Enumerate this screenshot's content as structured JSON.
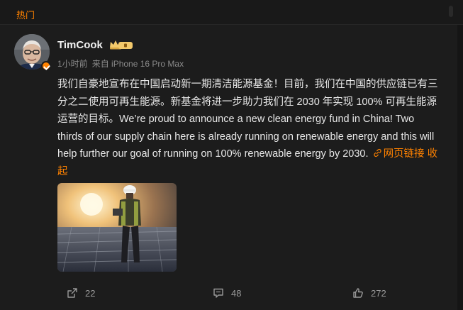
{
  "top": {
    "tab_label": "热门"
  },
  "post": {
    "username": "TimCook",
    "time": "1小时前",
    "source": "来自 iPhone 16 Pro Max",
    "text": "我们自豪地宣布在中国启动新一期清洁能源基金！目前，我们在中国的供应链已有三分之二使用可再生能源。新基金将进一步助力我们在 2030 年实现 100% 可再生能源运营的目标。We’re proud to announce a new clean energy fund in China! Two thirds of our supply chain here is already running on renewable energy and this will help further our goal of running on 100% renewable energy by 2030.",
    "link_label": "网页链接",
    "collapse_label": "收起"
  },
  "actions": {
    "repost_count": "22",
    "comment_count": "48",
    "like_count": "272"
  },
  "colors": {
    "accent": "#ff8200"
  }
}
